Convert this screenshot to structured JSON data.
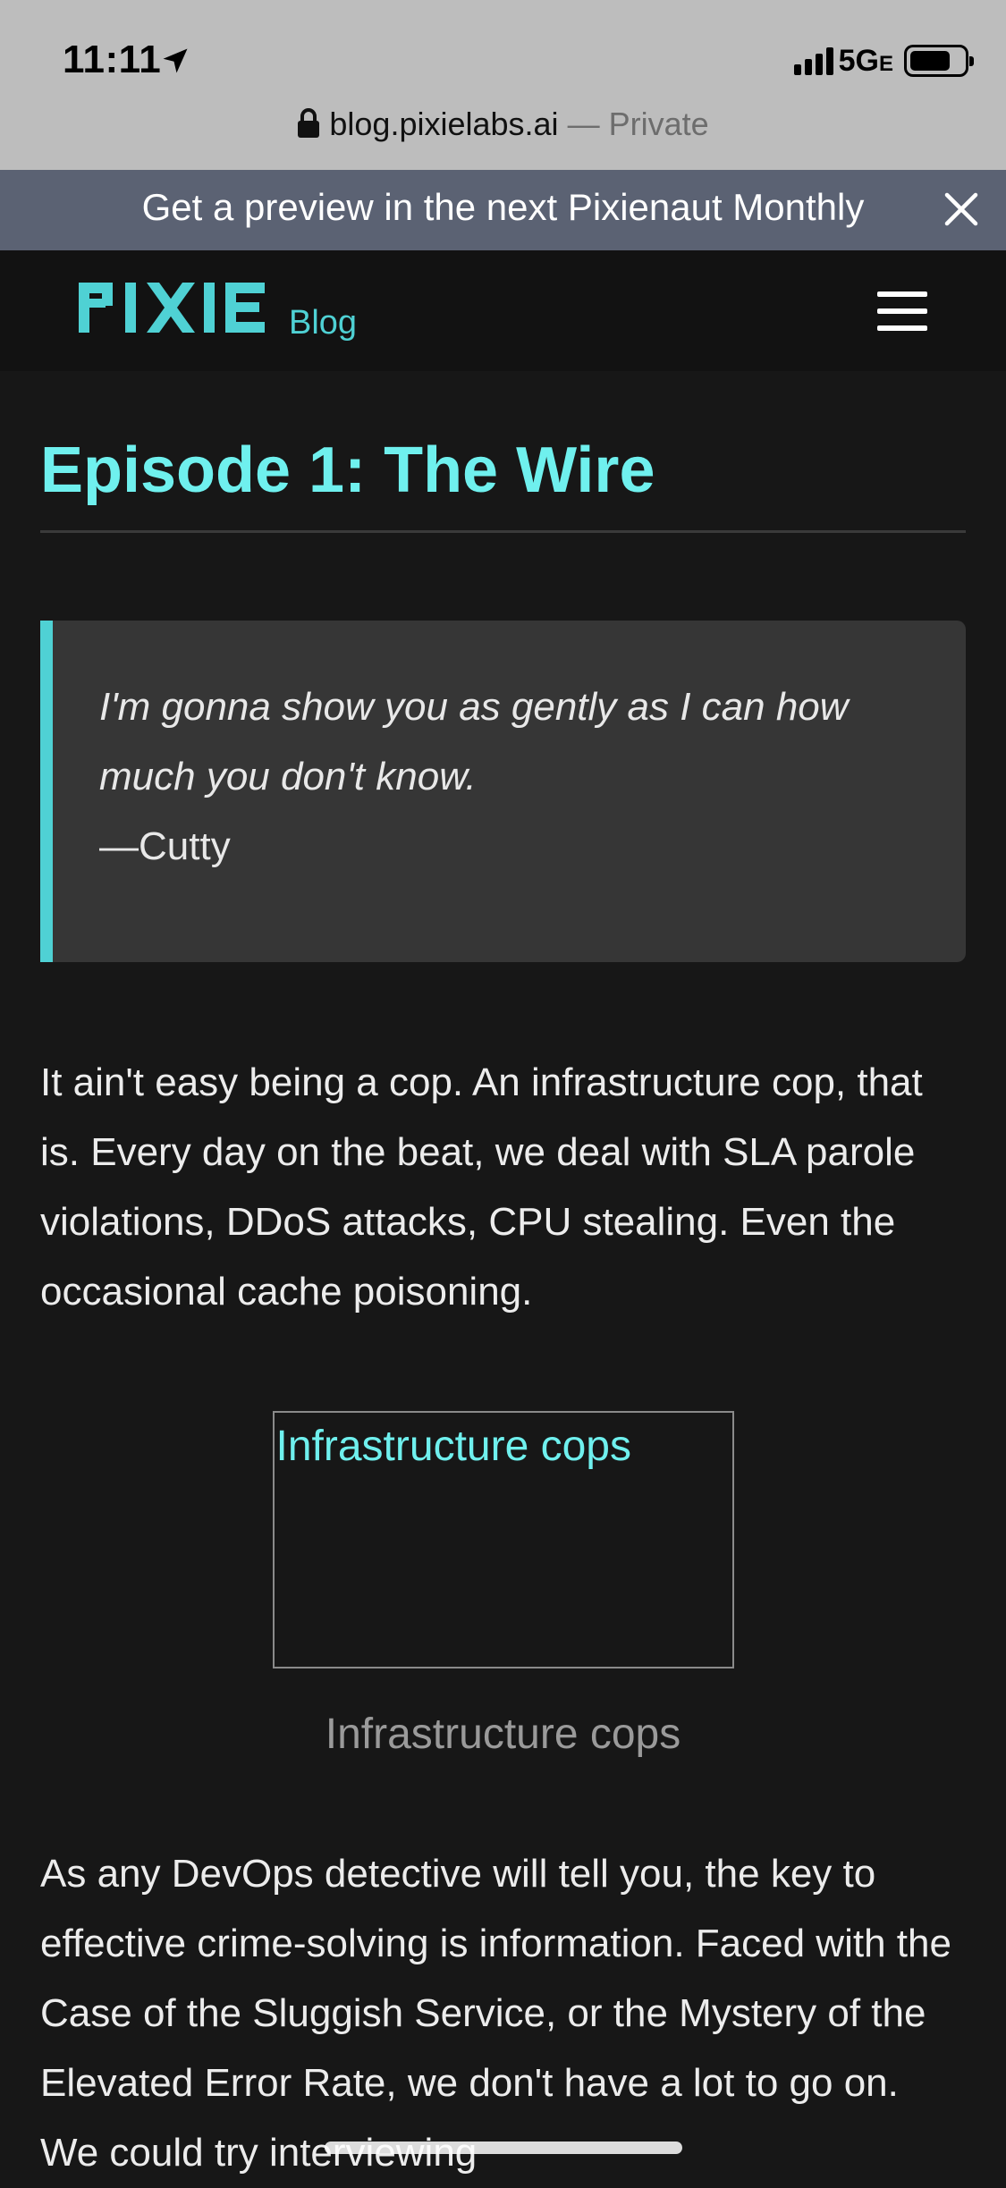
{
  "status_bar": {
    "time": "11:11",
    "network": "5G",
    "network_suffix": "E",
    "battery_level": 0.75
  },
  "browser": {
    "domain": "blog.pixielabs.ai",
    "private_label": "— Private"
  },
  "banner": {
    "text": "Get a preview in the next Pixienaut Monthly"
  },
  "header": {
    "logo_text": "PIXIE",
    "logo_suffix": "Blog"
  },
  "article": {
    "title": "Episode 1: The Wire",
    "quote": {
      "text": "I'm gonna show you as gently as I can how much you don't know.",
      "author": "—Cutty"
    },
    "paragraph_1": "It ain't easy being a cop. An infrastructure cop, that is. Every day on the beat, we deal with SLA parole violations, DDoS attacks, CPU stealing. Even the occasional cache poisoning.",
    "figure": {
      "alt_text": "Infrastructure cops",
      "caption": "Infrastructure cops"
    },
    "paragraph_2": "As any DevOps detective will tell you, the key to effective crime-solving is information. Faced with the Case of the Sluggish Service, or the Mystery of the Elevated Error Rate, we don't have a lot to go on. We could try interviewing"
  },
  "colors": {
    "accent": "#4fd1d4",
    "title": "#6ff0ee",
    "banner_bg": "#5b6273",
    "page_bg": "#171717"
  }
}
